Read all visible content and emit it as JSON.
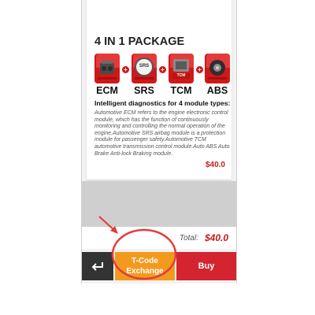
{
  "card": {
    "title": "4 IN 1 PACKAGE",
    "modules": [
      {
        "label": "ECM",
        "icon": "ecm-module-icon"
      },
      {
        "label": "SRS",
        "icon": "srs-module-icon",
        "badge": "SRS"
      },
      {
        "label": "TCM",
        "icon": "tcm-module-icon",
        "badge": "TCM"
      },
      {
        "label": "ABS",
        "icon": "abs-module-icon"
      }
    ],
    "plus_symbol": "+",
    "subtitle": "Intelligent diagnostics for 4 module types:",
    "description": "Automotive ECM refers to the engine electronic control module, which has the function of continuously monitoring and controlling the normal operation of the engine.Automotive SRS airbag module is a protection module for passenger safety.Automotive TCM automotive transmission control module.Auto ABS Auto Brake Anti-lock Braking module.",
    "price": "$40.0"
  },
  "footer": {
    "total_label": "Total:",
    "total_value": "$40.0"
  },
  "buttons": {
    "back_icon": "return-arrow-icon",
    "tcode_line1": "T-Code",
    "tcode_line2": "Exchange",
    "buy": "Buy"
  },
  "annotations": {
    "arrow_color": "#e53a3a",
    "circle_color": "#e53a3a"
  },
  "colors": {
    "brand_red": "#d01818",
    "price_red": "#c61b1b",
    "tcode_orange": "#f39a1e",
    "buy_red": "#d4242f",
    "back_dark": "#333333"
  }
}
